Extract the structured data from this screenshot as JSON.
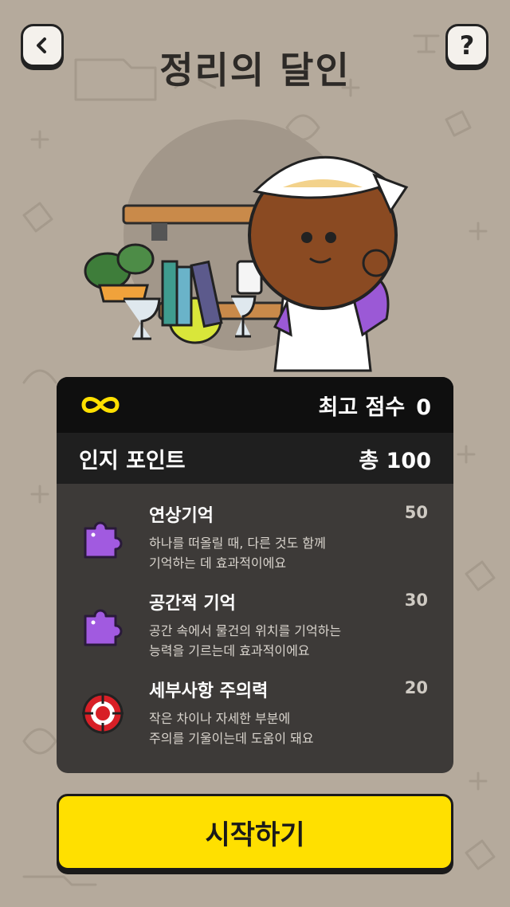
{
  "header": {
    "title": "정리의 달인",
    "help_label": "?"
  },
  "score": {
    "best_label": "최고 점수",
    "best_value": "0"
  },
  "points": {
    "label": "인지 포인트",
    "total": "총 100"
  },
  "skills": [
    {
      "name": "연상기억",
      "value": "50",
      "desc1": "하나를 떠올릴 때, 다른 것도 함께",
      "desc2": "기억하는 데 효과적이에요",
      "icon": "puzzle-icon"
    },
    {
      "name": "공간적 기억",
      "value": "30",
      "desc1": "공간 속에서 물건의 위치를 기억하는",
      "desc2": "능력을 기르는데 효과적이에요",
      "icon": "puzzle-icon"
    },
    {
      "name": "세부사항 주의력",
      "value": "20",
      "desc1": "작은 차이나 자세한 부분에",
      "desc2": "주의를 기울이는데 도움이 돼요",
      "icon": "target-icon"
    }
  ],
  "start_button": {
    "label": "시작하기"
  },
  "colors": {
    "background": "#b5aa9c",
    "accent_yellow": "#ffe000",
    "puzzle_purple": "#a15ae0",
    "target_red": "#d81f26"
  }
}
